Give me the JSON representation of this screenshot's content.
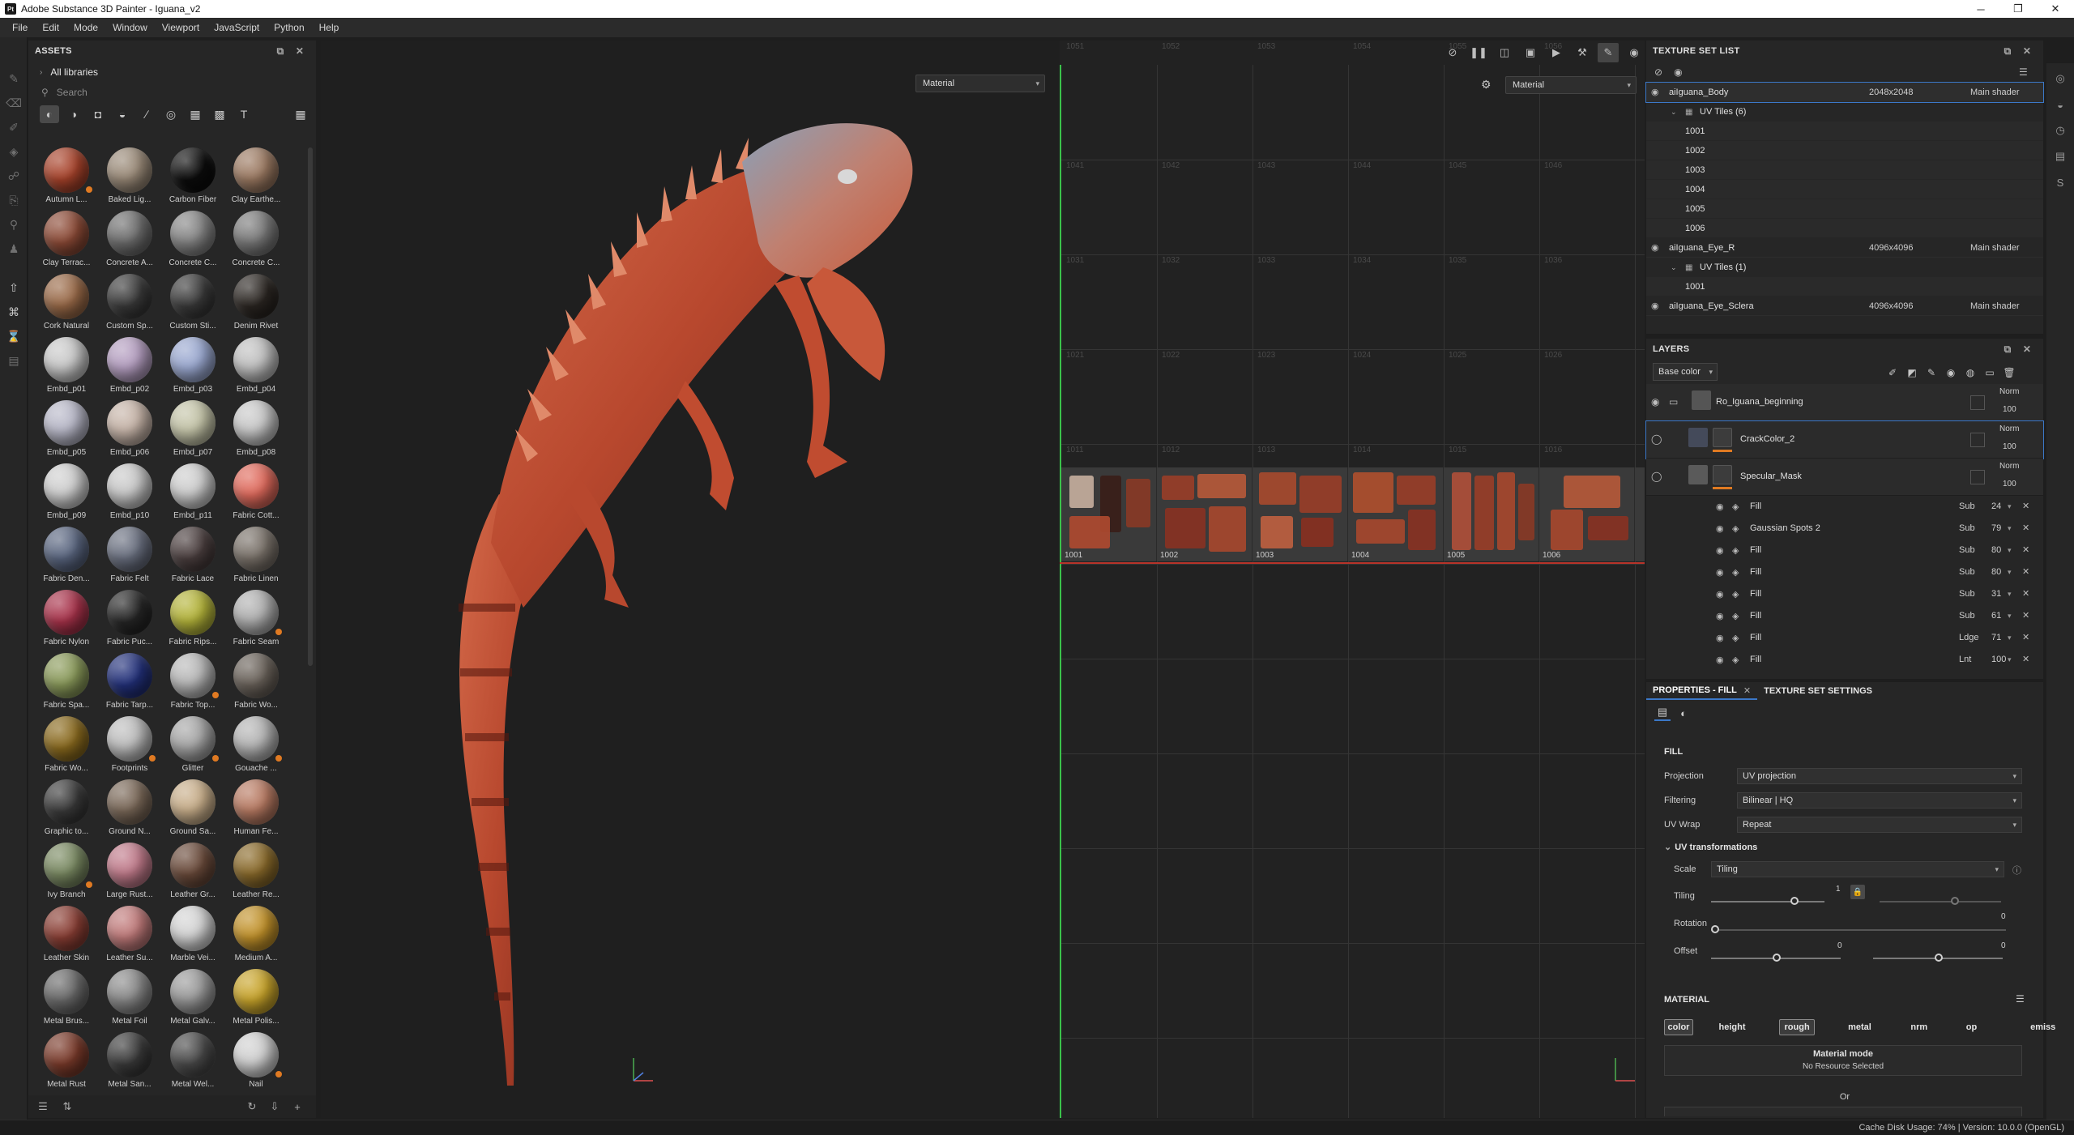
{
  "window": {
    "title": "Adobe Substance 3D Painter - Iguana_v2",
    "app_icon": "Pt",
    "controls": [
      "─",
      "❐",
      "✕"
    ]
  },
  "menu": [
    "File",
    "Edit",
    "Mode",
    "Window",
    "Viewport",
    "JavaScript",
    "Python",
    "Help"
  ],
  "assets": {
    "title": "ASSETS",
    "library": "All libraries",
    "search_placeholder": "Search",
    "materials": [
      {
        "label": "Autumn L...",
        "color": "#a8432b",
        "badge": true
      },
      {
        "label": "Baked Lig...",
        "color": "#9a8a78",
        "badge": false
      },
      {
        "label": "Carbon Fiber",
        "color": "#0c0c0c",
        "badge": false
      },
      {
        "label": "Clay Earthe...",
        "color": "#9c7a62",
        "badge": false
      },
      {
        "label": "Clay Terrac...",
        "color": "#8c4a36",
        "badge": false
      },
      {
        "label": "Concrete A...",
        "color": "#6e6e6e",
        "badge": false
      },
      {
        "label": "Concrete C...",
        "color": "#858585",
        "badge": false
      },
      {
        "label": "Concrete C...",
        "color": "#7a7a7a",
        "badge": false
      },
      {
        "label": "Cork Natural",
        "color": "#9a6a48",
        "badge": false
      },
      {
        "label": "Custom Sp...",
        "color": "#3a3a3a",
        "badge": false
      },
      {
        "label": "Custom Sti...",
        "color": "#3a3a3a",
        "badge": false
      },
      {
        "label": "Denim Rivet",
        "color": "#2b2622",
        "badge": false
      },
      {
        "label": "Embd_p01",
        "color": "#c9c9c9",
        "badge": false
      },
      {
        "label": "Embd_p02",
        "color": "#b49ec0",
        "badge": false
      },
      {
        "label": "Embd_p03",
        "color": "#9aa8d0",
        "badge": false
      },
      {
        "label": "Embd_p04",
        "color": "#c0c0c0",
        "badge": false
      },
      {
        "label": "Embd_p05",
        "color": "#b8b8c8",
        "badge": false
      },
      {
        "label": "Embd_p06",
        "color": "#c6b4a8",
        "badge": false
      },
      {
        "label": "Embd_p07",
        "color": "#c4c4a8",
        "badge": false
      },
      {
        "label": "Embd_p08",
        "color": "#c8c8c8",
        "badge": false
      },
      {
        "label": "Embd_p09",
        "color": "#cfcfcf",
        "badge": false
      },
      {
        "label": "Embd_p10",
        "color": "#c9c9c9",
        "badge": false
      },
      {
        "label": "Embd_p11",
        "color": "#cdcdcd",
        "badge": false
      },
      {
        "label": "Fabric Cott...",
        "color": "#e06a5c",
        "badge": false
      },
      {
        "label": "Fabric Den...",
        "color": "#5a6680",
        "badge": false
      },
      {
        "label": "Fabric Felt",
        "color": "#6a7080",
        "badge": false
      },
      {
        "label": "Fabric Lace",
        "color": "#4a3e3e",
        "badge": false
      },
      {
        "label": "Fabric Linen",
        "color": "#7a726a",
        "badge": false
      },
      {
        "label": "Fabric Nylon",
        "color": "#a8324a",
        "badge": false
      },
      {
        "label": "Fabric Puc...",
        "color": "#262626",
        "badge": false
      },
      {
        "label": "Fabric Rips...",
        "color": "#b4b43a",
        "badge": false
      },
      {
        "label": "Fabric Seam",
        "color": "#b0b0b0",
        "badge": true
      },
      {
        "label": "Fabric Spa...",
        "color": "#8a9a5a",
        "badge": false
      },
      {
        "label": "Fabric Tarp...",
        "color": "#22307a",
        "badge": false
      },
      {
        "label": "Fabric Top...",
        "color": "#b8b8b8",
        "badge": true
      },
      {
        "label": "Fabric Wo...",
        "color": "#6a625a",
        "badge": false
      },
      {
        "label": "Fabric Wo...",
        "color": "#8a6a1e",
        "badge": false
      },
      {
        "label": "Footprints",
        "color": "#bdbdbd",
        "badge": true
      },
      {
        "label": "Glitter",
        "color": "#a6a6a6",
        "badge": true
      },
      {
        "label": "Gouache ...",
        "color": "#b4b4b4",
        "badge": true
      },
      {
        "label": "Graphic to...",
        "color": "#3a3a3a",
        "badge": false
      },
      {
        "label": "Ground N...",
        "color": "#7a6858",
        "badge": false
      },
      {
        "label": "Ground Sa...",
        "color": "#c8ae8a",
        "badge": false
      },
      {
        "label": "Human Fe...",
        "color": "#b87a62",
        "badge": false
      },
      {
        "label": "Ivy Branch",
        "color": "#7a8a62",
        "badge": true
      },
      {
        "label": "Large Rust...",
        "color": "#c07a8a",
        "badge": false
      },
      {
        "label": "Leather Gr...",
        "color": "#6a4a3a",
        "badge": false
      },
      {
        "label": "Leather Re...",
        "color": "#8a6a2a",
        "badge": false
      },
      {
        "label": "Leather Skin",
        "color": "#8a3e34",
        "badge": false
      },
      {
        "label": "Leather Su...",
        "color": "#c07a7a",
        "badge": false
      },
      {
        "label": "Marble Vei...",
        "color": "#d4d4d4",
        "badge": false
      },
      {
        "label": "Medium A...",
        "color": "#c2922a",
        "badge": false
      },
      {
        "label": "Metal Brus...",
        "color": "#6a6a6a",
        "badge": false
      },
      {
        "label": "Metal Foil",
        "color": "#8a8a8a",
        "badge": false
      },
      {
        "label": "Metal Galv...",
        "color": "#9a9a9a",
        "badge": false
      },
      {
        "label": "Metal Polis...",
        "color": "#c8a42a",
        "badge": false
      },
      {
        "label": "Metal Rust",
        "color": "#7a3a2a",
        "badge": false
      },
      {
        "label": "Metal San...",
        "color": "#3a3a3a",
        "badge": false
      },
      {
        "label": "Metal Wel...",
        "color": "#4a4a4a",
        "badge": false
      },
      {
        "label": "Nail",
        "color": "#d0d0d0",
        "badge": true
      }
    ]
  },
  "viewport3d": {
    "mode": "Material"
  },
  "viewport2d": {
    "mode": "Material",
    "uv_tiles": [
      "1001",
      "1002",
      "1003",
      "1004",
      "1005",
      "1006"
    ],
    "ghost_rows": [
      [
        "1051",
        "1052",
        "1053",
        "1054",
        "1055",
        "1056"
      ],
      [
        "1041",
        "1042",
        "1043",
        "1044",
        "1045",
        "1046"
      ],
      [
        "1031",
        "1032",
        "1033",
        "1034",
        "1035",
        "1036"
      ],
      [
        "1021",
        "1022",
        "1023",
        "1024",
        "1025",
        "1026"
      ],
      [
        "1011",
        "1012",
        "1013",
        "1014",
        "1015",
        "1016"
      ]
    ]
  },
  "texture_set_list": {
    "title": "TEXTURE SET LIST",
    "sets": [
      {
        "name": "aiIguana_Body",
        "resolution": "2048x2048",
        "shader": "Main shader",
        "uv_group": "UV Tiles (6)",
        "tiles": [
          "1001",
          "1002",
          "1003",
          "1004",
          "1005",
          "1006"
        ]
      },
      {
        "name": "aiIguana_Eye_R",
        "resolution": "4096x4096",
        "shader": "Main shader",
        "uv_group": "UV Tiles (1)",
        "tiles": [
          "1001"
        ]
      },
      {
        "name": "aiIguana_Eye_Sclera",
        "resolution": "4096x4096",
        "shader": "Main shader"
      }
    ]
  },
  "layers": {
    "title": "LAYERS",
    "channel": "Base color",
    "items": [
      {
        "name": "Ro_Iguana_beginning",
        "blend": "Norm",
        "opacity": "100"
      },
      {
        "name": "CrackColor_2",
        "blend": "Norm",
        "opacity": "100"
      },
      {
        "name": "Specular_Mask",
        "blend": "Norm",
        "opacity": "100"
      }
    ],
    "effects": [
      {
        "name": "Fill",
        "blend": "Sub",
        "opacity": "24"
      },
      {
        "name": "Gaussian Spots 2",
        "blend": "Sub",
        "opacity": "79"
      },
      {
        "name": "Fill",
        "blend": "Sub",
        "opacity": "80"
      },
      {
        "name": "Fill",
        "blend": "Sub",
        "opacity": "80"
      },
      {
        "name": "Fill",
        "blend": "Sub",
        "opacity": "31"
      },
      {
        "name": "Fill",
        "blend": "Sub",
        "opacity": "61"
      },
      {
        "name": "Fill",
        "blend": "Ldge",
        "opacity": "71"
      },
      {
        "name": "Fill",
        "blend": "Lnt",
        "opacity": "100"
      }
    ]
  },
  "properties": {
    "tab_fill": "PROPERTIES - FILL",
    "tab_texset": "TEXTURE SET SETTINGS",
    "section_fill": "FILL",
    "projection_label": "Projection",
    "projection": "UV projection",
    "filtering_label": "Filtering",
    "filtering": "Bilinear | HQ",
    "uvwrap_label": "UV Wrap",
    "uvwrap": "Repeat",
    "uvtrans_label": "UV transformations",
    "scale_label": "Scale",
    "scale": "Tiling",
    "tiling_label": "Tiling",
    "tiling_value": "1",
    "rotation_label": "Rotation",
    "rotation_value": "0",
    "offset_label": "Offset",
    "offset_u": "0",
    "offset_v": "0",
    "section_material": "MATERIAL",
    "channels": [
      "color",
      "height",
      "rough",
      "metal",
      "nrm",
      "op",
      "emiss"
    ],
    "active_channels": [
      "color",
      "rough"
    ],
    "material_mode_label": "Material mode",
    "no_resource": "No Resource Selected",
    "or_label": "Or"
  },
  "status": {
    "text": "Cache Disk Usage:  74% | Version: 10.0.0 (OpenGL)"
  }
}
